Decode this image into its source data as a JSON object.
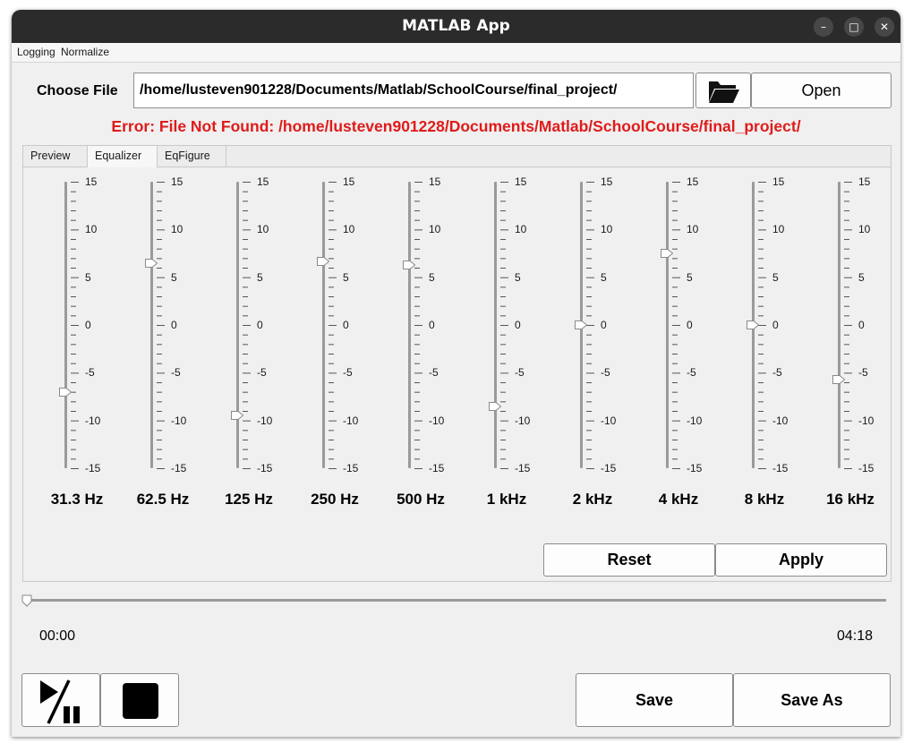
{
  "window": {
    "title": "MATLAB App",
    "controls": [
      "–",
      "□",
      "✕"
    ]
  },
  "menu": [
    "Logging",
    "Normalize"
  ],
  "file": {
    "label": "Choose File",
    "path": "/home/lusteven901228/Documents/Matlab/SchoolCourse/final_project/",
    "browse_icon": "folder-open-icon",
    "open_label": "Open",
    "error": "Error: File Not Found: /home/lusteven901228/Documents/Matlab/SchoolCourse/final_project/"
  },
  "tabs": [
    {
      "label": "Preview",
      "active": false
    },
    {
      "label": "Equalizer",
      "active": true
    },
    {
      "label": "EqFigure",
      "active": false
    }
  ],
  "equalizer": {
    "scale_min": -15,
    "scale_max": 15,
    "tick_labels": [
      "15",
      "10",
      "5",
      "0",
      "-5",
      "-10",
      "-15"
    ],
    "bands": [
      {
        "label": "31.3 Hz",
        "gain": -7
      },
      {
        "label": "62.5 Hz",
        "gain": 6.5
      },
      {
        "label": "125 Hz",
        "gain": -9.5
      },
      {
        "label": "250 Hz",
        "gain": 6.7
      },
      {
        "label": "500 Hz",
        "gain": 6.3
      },
      {
        "label": "1 kHz",
        "gain": -8.5
      },
      {
        "label": "2 kHz",
        "gain": 0
      },
      {
        "label": "4 kHz",
        "gain": 7.5
      },
      {
        "label": "8 kHz",
        "gain": 0
      },
      {
        "label": "16 kHz",
        "gain": -5.7
      }
    ],
    "reset_label": "Reset",
    "apply_label": "Apply"
  },
  "playback": {
    "position_fraction": 0,
    "current_time": "00:00",
    "total_time": "04:18",
    "play_pause_icon": "play-pause-icon",
    "stop_icon": "stop-icon"
  },
  "actions": {
    "save_label": "Save",
    "save_as_label": "Save As"
  }
}
